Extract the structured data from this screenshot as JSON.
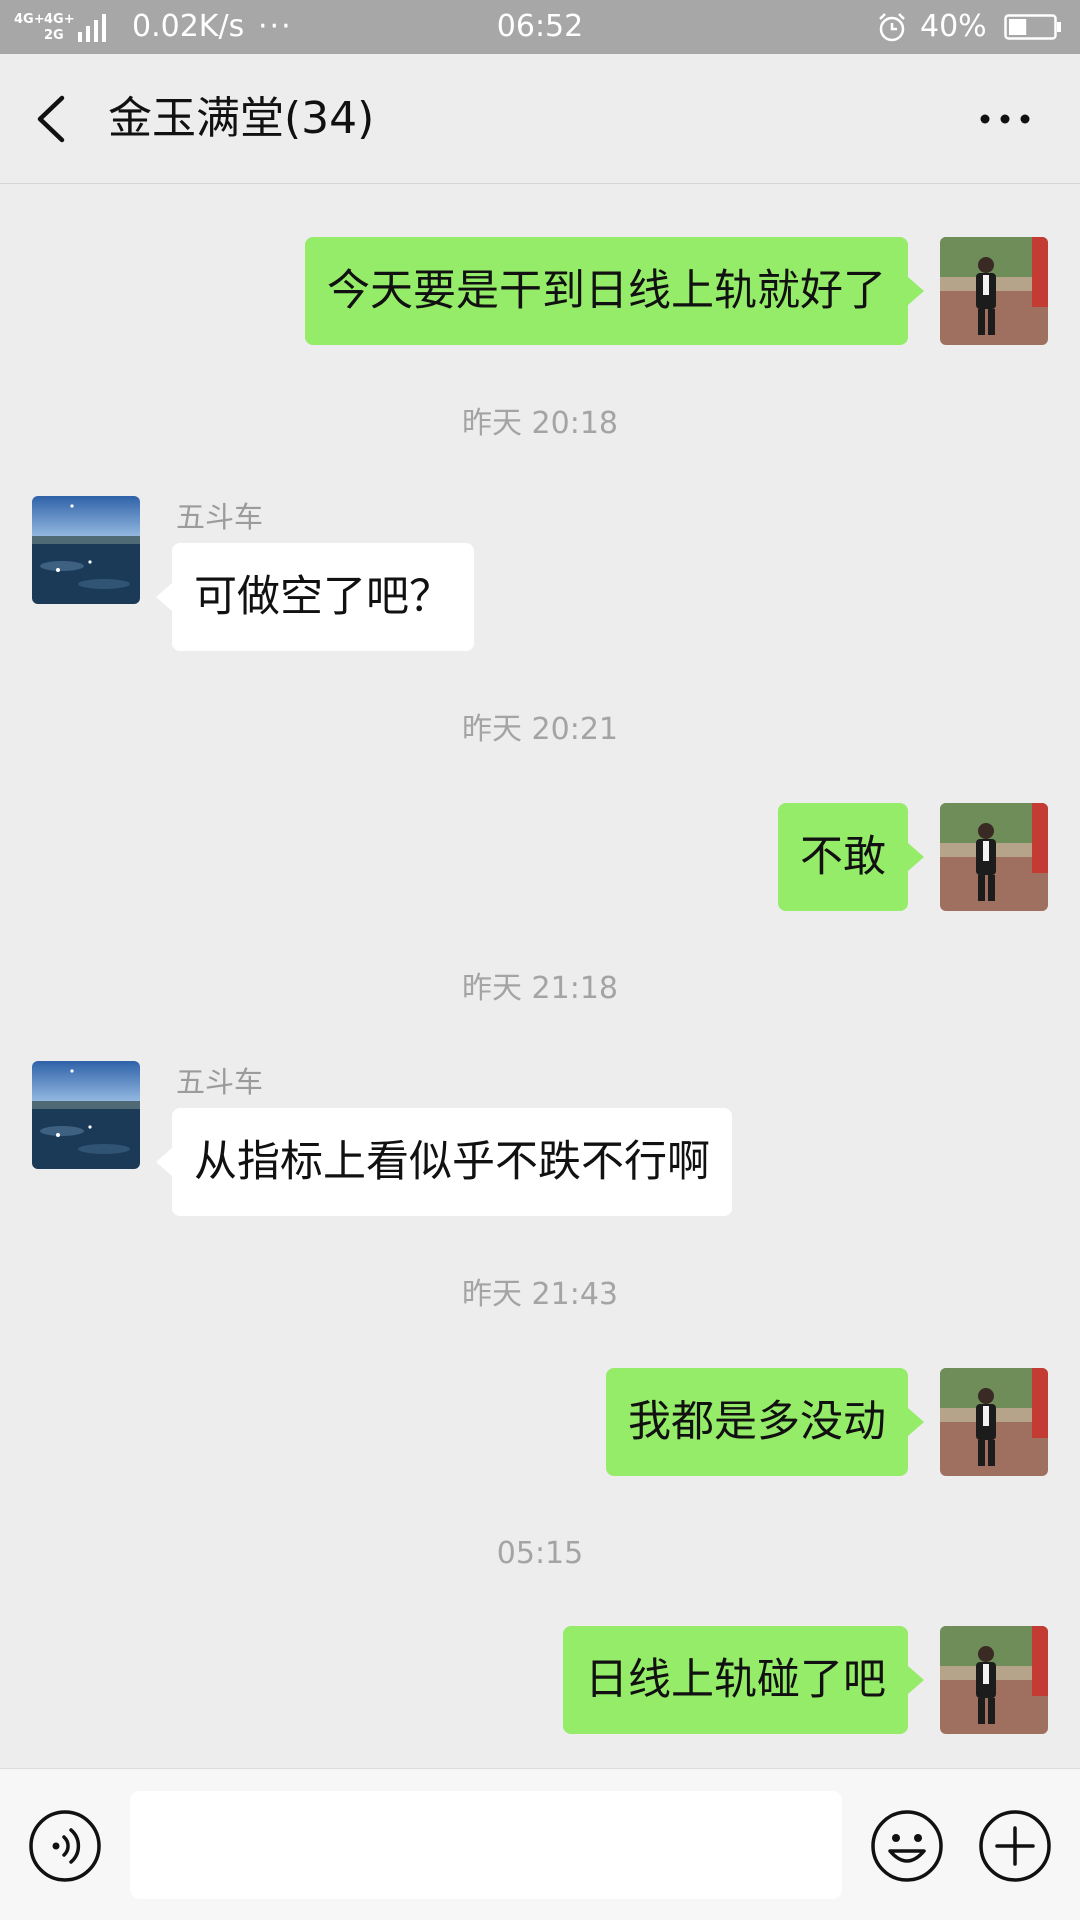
{
  "status_bar": {
    "network": "4G+ 4G+ 2G",
    "speed": "0.02K/s",
    "dots": "···",
    "time": "06:52",
    "battery_percent": "40%",
    "battery_level": 0.4,
    "icons": [
      "signal-icon",
      "alarm-icon",
      "battery-icon"
    ]
  },
  "header": {
    "title": "金玉满堂(34)",
    "icons": [
      "back-icon",
      "more-icon"
    ]
  },
  "messages": [
    {
      "direction": "out",
      "text": "今天要是干到日线上轨就好了"
    },
    {
      "timestamp": "昨天 20:18"
    },
    {
      "direction": "in",
      "sender": "五斗车",
      "text": "可做空了吧？"
    },
    {
      "timestamp": "昨天 20:21"
    },
    {
      "direction": "out",
      "text": "不敢"
    },
    {
      "timestamp": "昨天 21:18"
    },
    {
      "direction": "in",
      "sender": "五斗车",
      "text": "从指标上看似乎不跌不行啊"
    },
    {
      "timestamp": "昨天 21:43"
    },
    {
      "direction": "out",
      "text": "我都是多没动"
    },
    {
      "timestamp": "05:15"
    },
    {
      "direction": "out",
      "text": "日线上轨碰了吧"
    }
  ],
  "input_bar": {
    "value": "",
    "icons": [
      "voice-icon",
      "emoji-icon",
      "plus-icon"
    ]
  },
  "colors": {
    "outgoing_bubble": "#95ec69",
    "incoming_bubble": "#ffffff",
    "background": "#ededed",
    "status_bar": "#a7a7a7"
  }
}
